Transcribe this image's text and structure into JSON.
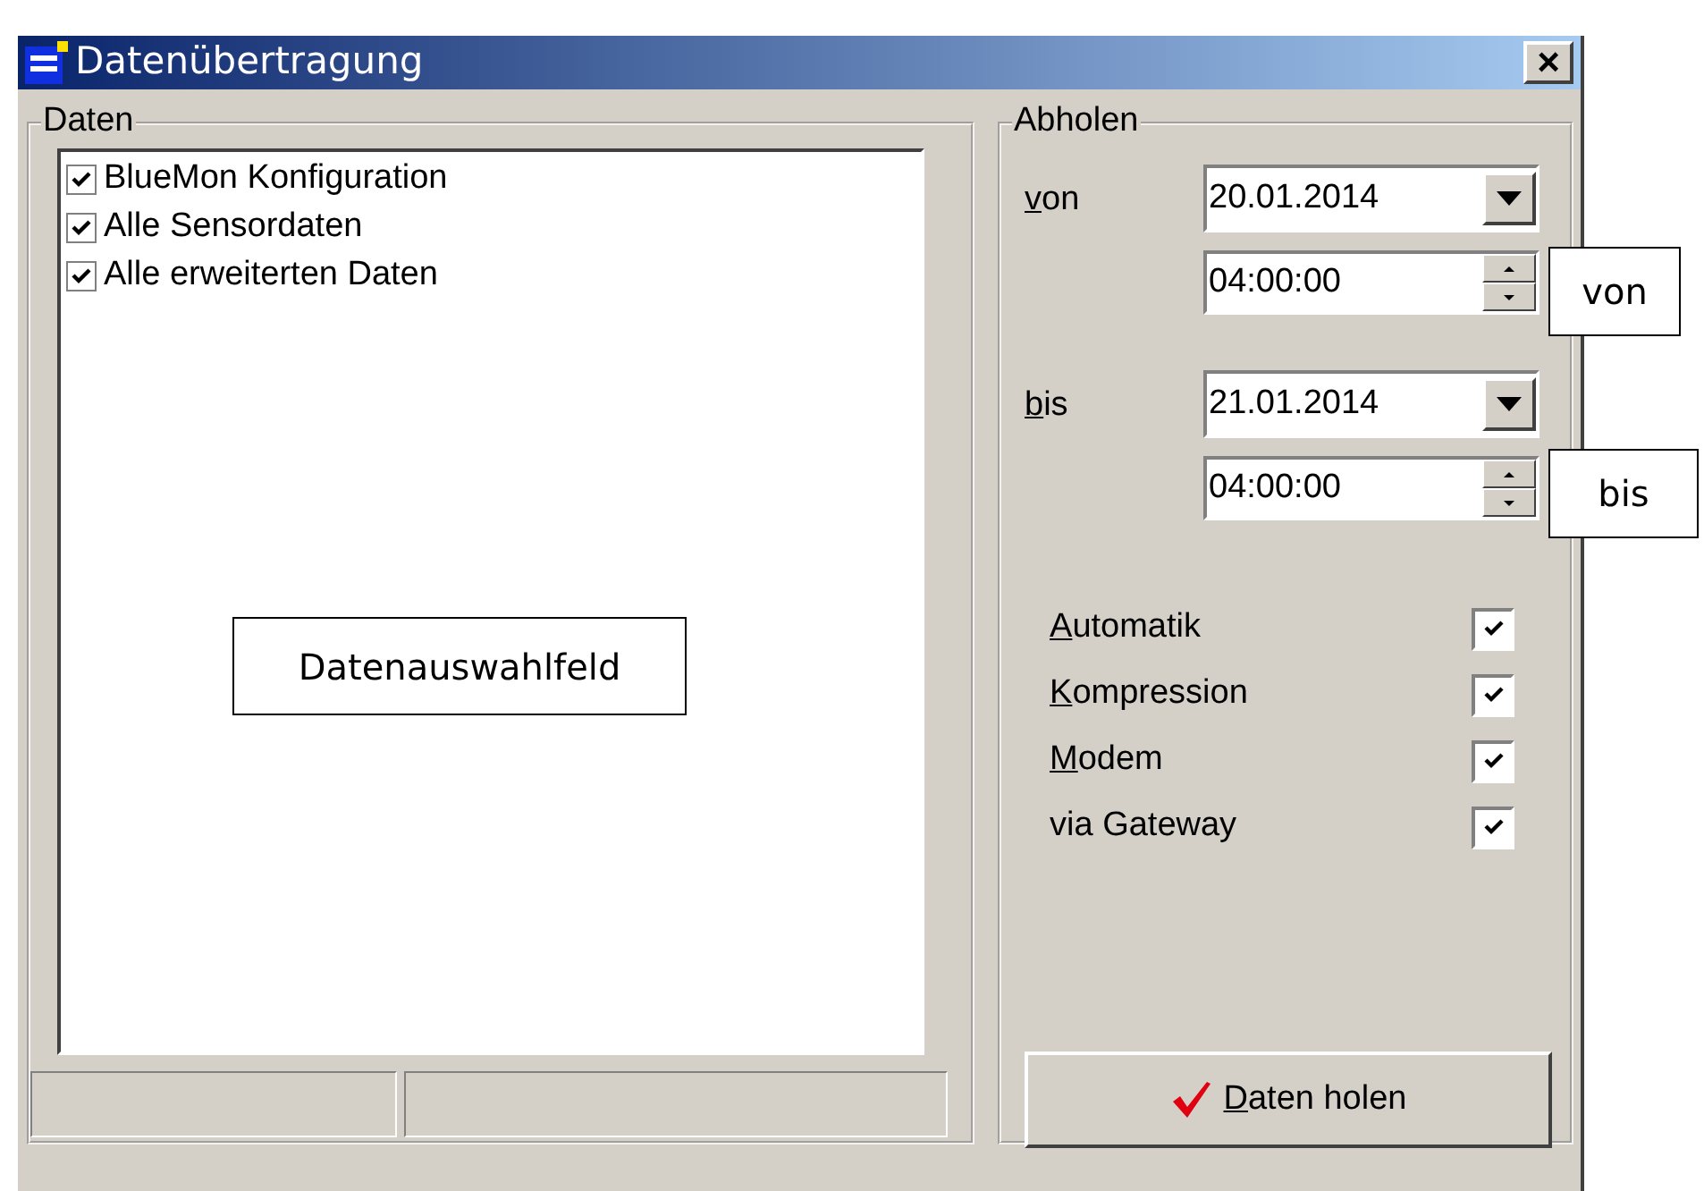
{
  "window": {
    "title": "Datenübertragung",
    "close": "×"
  },
  "data_group": {
    "title": "Daten",
    "items": [
      {
        "label": "BlueMon Konfiguration",
        "checked": true
      },
      {
        "label": "Alle Sensordaten",
        "checked": true
      },
      {
        "label": "Alle erweiterten Daten",
        "checked": true
      }
    ]
  },
  "fetch_group": {
    "title": "Abholen",
    "ranges": [
      {
        "label": "von",
        "mnemonic": true,
        "date": "20.01.2014",
        "time": "04:00:00"
      },
      {
        "label": "bis",
        "mnemonic": true,
        "date": "21.01.2014",
        "time": "04:00:00"
      }
    ],
    "options": [
      {
        "label": "Automatik",
        "mnemonic": true,
        "checked": true
      },
      {
        "label": "Kompression",
        "mnemonic": true,
        "checked": true
      },
      {
        "label": "Modem",
        "mnemonic": true,
        "checked": true
      },
      {
        "label": "via Gateway",
        "mnemonic": false,
        "checked": true
      }
    ],
    "button": {
      "label": "Daten holen",
      "mnemonic": true
    }
  },
  "callouts": [
    {
      "text": "Datenauswahlfeld"
    },
    {
      "text": "von"
    },
    {
      "text": "bis"
    }
  ]
}
